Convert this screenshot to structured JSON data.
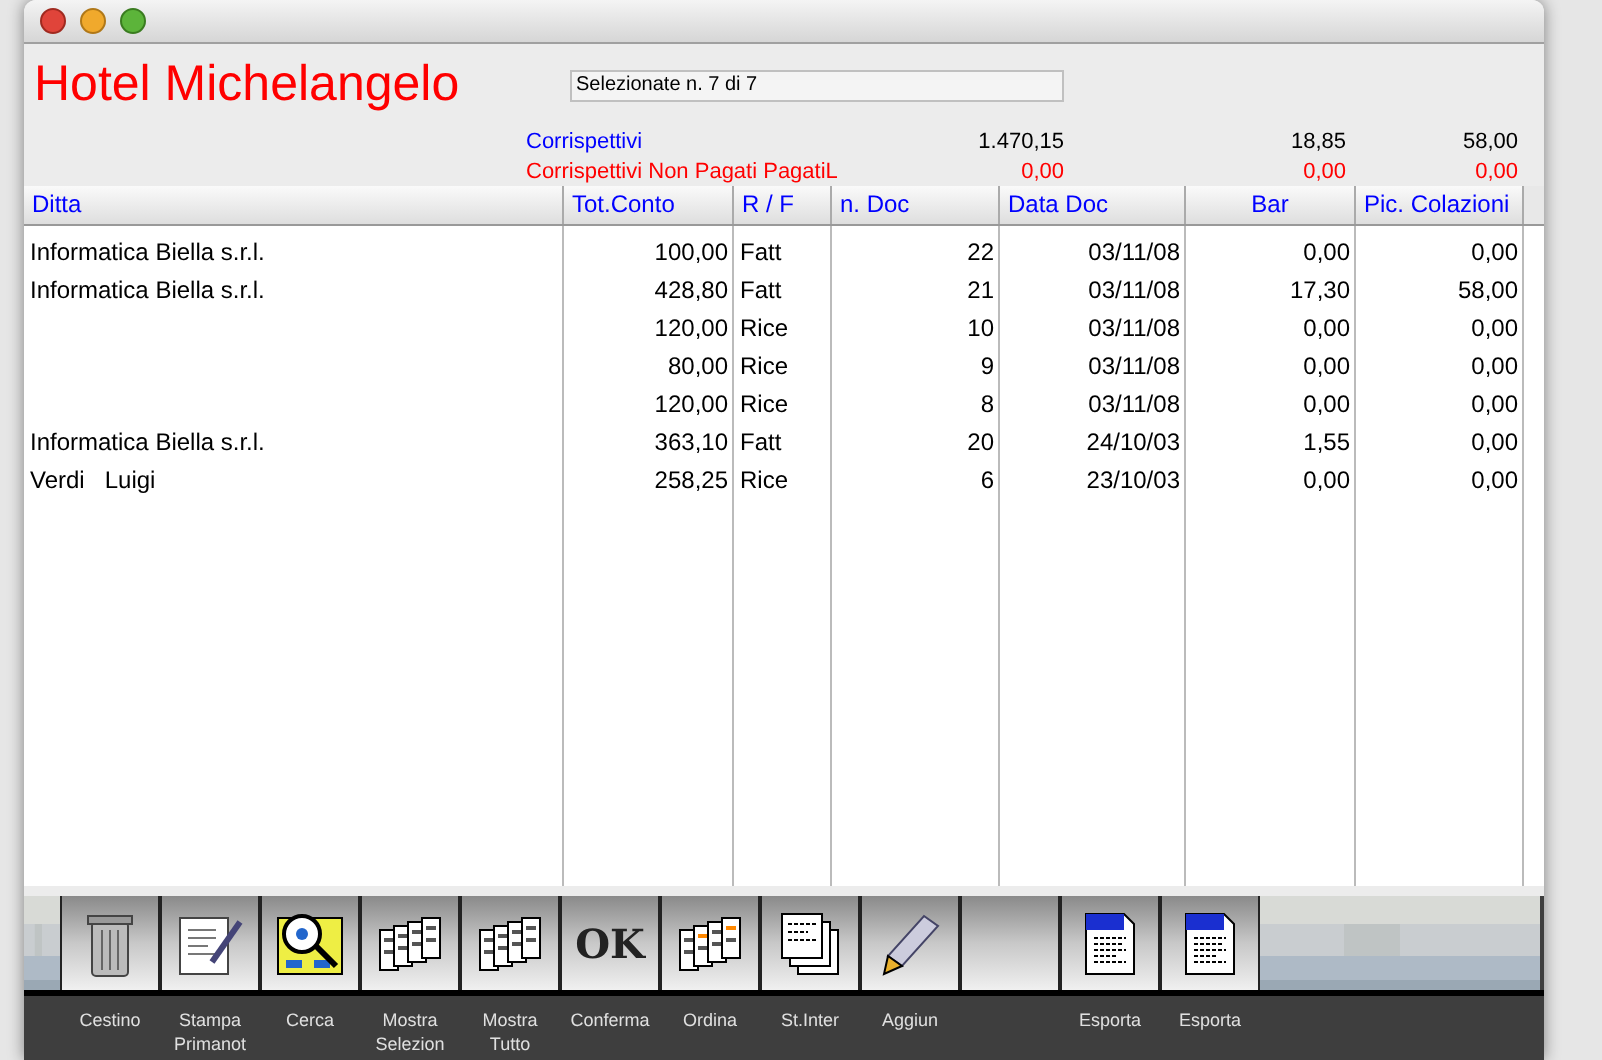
{
  "window": {
    "title": "Hotel Michelangelo"
  },
  "selection": {
    "value": "Selezionate n. 7 di 7"
  },
  "totals": [
    {
      "kind": "paid",
      "label": "Corrispettivi",
      "values": [
        "1.470,15",
        "18,85",
        "58,00"
      ]
    },
    {
      "kind": "unpaid",
      "label": "Corrispettivi Non Pagati PagatiL",
      "values": [
        "0,00",
        "0,00",
        "0,00"
      ]
    }
  ],
  "table": {
    "columns": [
      "Ditta",
      "Tot.Conto",
      "R / F",
      "n. Doc",
      "Data Doc",
      "Bar",
      "Pic. Colazioni"
    ],
    "rows": [
      [
        "Informatica Biella s.r.l.",
        "100,00",
        "Fatt",
        "22",
        "03/11/08",
        "0,00",
        "0,00"
      ],
      [
        "Informatica Biella s.r.l.",
        "428,80",
        "Fatt",
        "21",
        "03/11/08",
        "17,30",
        "58,00"
      ],
      [
        null,
        "120,00",
        "Rice",
        "10",
        "03/11/08",
        "0,00",
        "0,00"
      ],
      [
        null,
        "80,00",
        "Rice",
        "9",
        "03/11/08",
        "0,00",
        "0,00"
      ],
      [
        null,
        "120,00",
        "Rice",
        "8",
        "03/11/08",
        "0,00",
        "0,00"
      ],
      [
        "Informatica Biella s.r.l.",
        "363,10",
        "Fatt",
        "20",
        "24/10/03",
        "1,55",
        "0,00"
      ],
      [
        "Verdi   Luigi",
        "258,25",
        "Rice",
        "6",
        "23/10/03",
        "0,00",
        "0,00"
      ]
    ]
  },
  "toolbar": [
    {
      "kind": "trash",
      "label": "Cestino"
    },
    {
      "kind": "document-pen",
      "label": "Stampa Primanot"
    },
    {
      "kind": "search",
      "label": "Cerca"
    },
    {
      "kind": "files",
      "label": "Mostra Selezion"
    },
    {
      "kind": "files",
      "label": "Mostra Tutto"
    },
    {
      "kind": "text",
      "glyph": "OK",
      "label": "Conferma"
    },
    {
      "kind": "files-marked",
      "label": "Ordina"
    },
    {
      "kind": "pages",
      "label": "St.Inter"
    },
    {
      "kind": "pencil",
      "label": "Aggiun"
    },
    {
      "kind": "blank"
    },
    {
      "kind": "document-4d",
      "label": "Esporta"
    },
    {
      "kind": "document-4d",
      "label": "Esporta"
    }
  ]
}
